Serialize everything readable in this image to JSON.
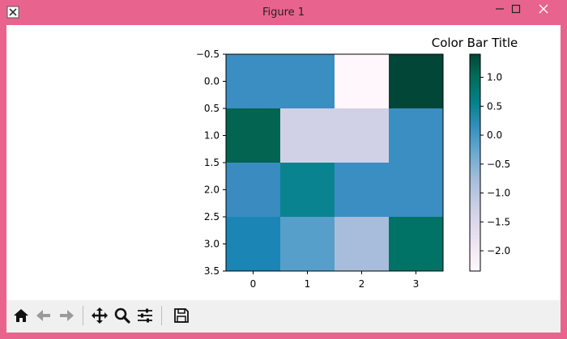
{
  "window": {
    "title": "Figure 1"
  },
  "toolbar": {
    "buttons": [
      "home-icon",
      "back-arrow-icon",
      "forward-arrow-icon",
      "pan-icon",
      "zoom-icon",
      "configure-subplots-icon",
      "save-icon"
    ]
  },
  "chart_data": {
    "type": "heatmap",
    "colormap": "PuBuGn",
    "rows": 4,
    "cols": 4,
    "values": [
      [
        -0.05,
        -0.05,
        -2.35,
        1.38
      ],
      [
        1.15,
        -1.55,
        -1.55,
        -0.05
      ],
      [
        -0.05,
        0.4,
        -0.05,
        -0.05
      ],
      [
        0.1,
        -0.45,
        -1.1,
        0.7
      ]
    ],
    "x_tick_labels": [
      "0",
      "1",
      "2",
      "3"
    ],
    "y_tick_labels": [
      "−0.5",
      "0.0",
      "0.5",
      "1.0",
      "1.5",
      "2.0",
      "2.5",
      "3.0",
      "3.5"
    ],
    "colorbar": {
      "title": "Color Bar Title",
      "range": [
        -2.35,
        1.4
      ],
      "tick_labels": [
        "1.0",
        "0.5",
        "0.0",
        "−0.5",
        "−1.0",
        "−1.5",
        "−2.0"
      ],
      "tick_values": [
        1.0,
        0.5,
        0.0,
        -0.5,
        -1.0,
        -1.5,
        -2.0
      ]
    },
    "colors": [
      "#3b8ec2",
      "#3b8ec2",
      "#fff7fb",
      "#014636",
      "#026451",
      "#d0d1e6",
      "#d0d1e6",
      "#3b8ec2",
      "#3a8bc0",
      "#0a8391",
      "#3b8ec2",
      "#3b8ec2",
      "#1b85b5",
      "#569fcb",
      "#a7bddb",
      "#017366"
    ]
  }
}
